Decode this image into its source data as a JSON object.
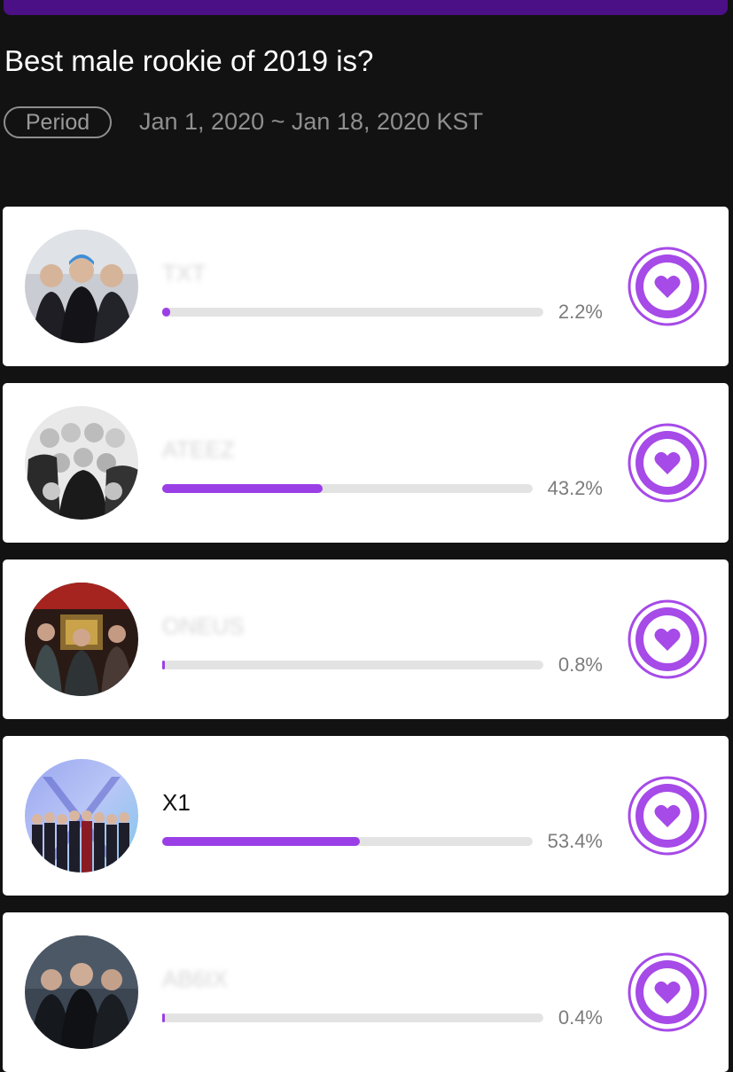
{
  "header": {
    "title": "Best male rookie of 2019 is?",
    "period_label": "Period",
    "period_dates": "Jan 1, 2020 ~ Jan 18, 2020 KST"
  },
  "colors": {
    "accent": "#9a3fe6",
    "top_bar": "#4b0f86",
    "background": "#121212"
  },
  "candidates": [
    {
      "name": "TXT",
      "name_blurred": true,
      "percent_label": "2.2%",
      "percent": 2.2
    },
    {
      "name": "ATEEZ",
      "name_blurred": true,
      "percent_label": "43.2%",
      "percent": 43.2
    },
    {
      "name": "ONEUS",
      "name_blurred": true,
      "percent_label": "0.8%",
      "percent": 0.8
    },
    {
      "name": "X1",
      "name_blurred": false,
      "percent_label": "53.4%",
      "percent": 53.4
    },
    {
      "name": "AB6IX",
      "name_blurred": true,
      "percent_label": "0.4%",
      "percent": 0.4
    }
  ],
  "icons": {
    "vote": "heart-icon"
  }
}
